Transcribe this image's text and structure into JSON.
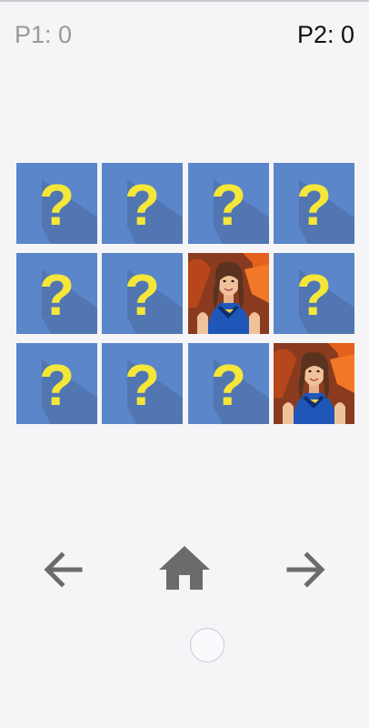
{
  "scoreboard": {
    "p1_label": "P1: 0",
    "p2_label": "P2: 0"
  },
  "board": {
    "rows": 3,
    "cols": 4,
    "cards": [
      {
        "state": "hidden",
        "icon": "question-mark-icon"
      },
      {
        "state": "hidden",
        "icon": "question-mark-icon"
      },
      {
        "state": "hidden",
        "icon": "question-mark-icon"
      },
      {
        "state": "hidden",
        "icon": "question-mark-icon"
      },
      {
        "state": "hidden",
        "icon": "question-mark-icon"
      },
      {
        "state": "hidden",
        "icon": "question-mark-icon"
      },
      {
        "state": "revealed",
        "icon": "superhero-girl-picture"
      },
      {
        "state": "hidden",
        "icon": "question-mark-icon"
      },
      {
        "state": "hidden",
        "icon": "question-mark-icon"
      },
      {
        "state": "hidden",
        "icon": "question-mark-icon"
      },
      {
        "state": "hidden",
        "icon": "question-mark-icon"
      },
      {
        "state": "revealed",
        "icon": "superhero-girl-picture"
      }
    ]
  },
  "navigation": {
    "back_icon": "arrow-left-icon",
    "home_icon": "home-icon",
    "forward_icon": "arrow-right-icon"
  },
  "colors": {
    "card_back": "#5b86c9",
    "question_mark": "#f5e63a",
    "nav_icon": "#6b6b6b"
  }
}
